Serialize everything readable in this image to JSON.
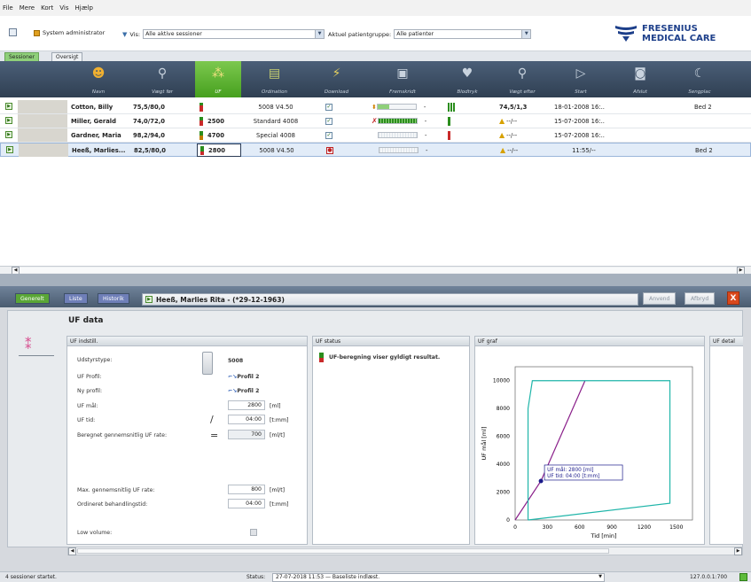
{
  "menu": [
    "File",
    "Mere",
    "Kort",
    "Vis",
    "Hjælp"
  ],
  "toolbar": {
    "user": "System administrator",
    "filter_label": "Vis:",
    "filter_value": "Alle aktive sessioner",
    "group_label": "Aktuel patientgruppe:",
    "group_value": "Alle patienter",
    "logo_line1": "FRESENIUS",
    "logo_line2": "MEDICAL CARE"
  },
  "tabs": [
    "Sessioner",
    "Oversigt"
  ],
  "columns": [
    "Navn",
    "Vægt før",
    "UF",
    "Ordination",
    "Download",
    "Fremskridt",
    "Blodtryk",
    "Vægt efter",
    "Start",
    "Afslut",
    "Sengplac"
  ],
  "rows": [
    {
      "name": "Cotton, Billy",
      "weight_before": "75,5/80,0",
      "uf": "",
      "ordination": "5008 V4.50",
      "weight_after": "74,5/1,3",
      "start": "18-01-2008 16:..",
      "bed": "Bed 2",
      "progress_dash": "-"
    },
    {
      "name": "Miller, Gerald",
      "weight_before": "74,0/72,0",
      "uf": "2500",
      "ordination": "Standard 4008",
      "weight_after": "--/--",
      "start": "15-07-2008 16:..",
      "bed": "",
      "progress_dash": "-"
    },
    {
      "name": "Gardner, Maria",
      "weight_before": "98,2/94,0",
      "uf": "4700",
      "ordination": "Special 4008",
      "weight_after": "--/--",
      "start": "15-07-2008 16:..",
      "bed": "",
      "progress_dash": "-"
    },
    {
      "name": "Heeß, Marlies...",
      "weight_before": "82,5/80,0",
      "uf": "2800",
      "ordination": "5008 V4.50",
      "weight_after": "--/--",
      "start": "11:55/--",
      "bed": "Bed 2",
      "progress_dash": "-"
    }
  ],
  "lower": {
    "tabs": [
      "Generelt",
      "Liste",
      "Historik"
    ],
    "patient": "Heeß, Marlies Rita - (*29-12-1963)",
    "apply": "Anvend",
    "cancel": "Afbryd",
    "title": "UF data",
    "sect_settings": "UF indstill.",
    "sect_status": "UF status",
    "sect_graph": "UF graf",
    "sect_detail": "UF detal",
    "device_label": "Udstyrstype:",
    "device_value": "5008",
    "profile_label": "UF Profil:",
    "profile_value": "Profil 2",
    "next_profile_label": "Ny profil:",
    "next_profile_value": "Profil 2",
    "goal_label": "UF mål:",
    "goal_value": "2800",
    "goal_unit": "[ml]",
    "time_label": "UF tid:",
    "time_value": "04:00",
    "time_unit": "[t:mm]",
    "rate_label": "Beregnet gennemsnitlig UF rate:",
    "rate_value": "700",
    "rate_unit": "[ml/t]",
    "max_label": "Max. gennemsnitlig UF rate:",
    "max_value": "800",
    "max_unit": "[ml/t]",
    "ord_label": "Ordineret behandlingstid:",
    "ord_value": "04:00",
    "ord_unit": "[t:mm]",
    "low_label": "Low volume:",
    "status_text": "UF-beregning viser gyldigt resultat.",
    "op_slash": "/",
    "op_equal": "="
  },
  "chart_data": {
    "type": "line",
    "xlabel": "Tid [min]",
    "ylabel": "UF mål [ml]",
    "xlim": [
      0,
      1650
    ],
    "ylim": [
      0,
      11000
    ],
    "xticks": [
      0,
      300,
      600,
      900,
      1200,
      1500
    ],
    "yticks": [
      0,
      2000,
      4000,
      6000,
      8000,
      10000
    ],
    "series": [
      {
        "name": "",
        "color": "#8a1f8a",
        "points": [
          [
            0,
            0
          ],
          [
            240,
            2800
          ],
          [
            650,
            10000
          ]
        ]
      },
      {
        "name": "",
        "color": "#1fb5a9",
        "points": [
          [
            120,
            0
          ],
          [
            120,
            8000
          ],
          [
            160,
            10000
          ],
          [
            1440,
            10000
          ],
          [
            1440,
            1200
          ],
          [
            120,
            0
          ]
        ]
      }
    ],
    "marker": {
      "x": 240,
      "y": 2800
    },
    "annotation_line1": "UF mål: 2800 [ml]",
    "annotation_line2": "UF tid: 04:00 [t:mm]"
  },
  "status": {
    "left": "4 sessioner startet.",
    "status_label": "Status:",
    "status_value": "27-07-2018 11:53 — Baseliste indlæst.",
    "right": "127.0.0.1:700"
  }
}
